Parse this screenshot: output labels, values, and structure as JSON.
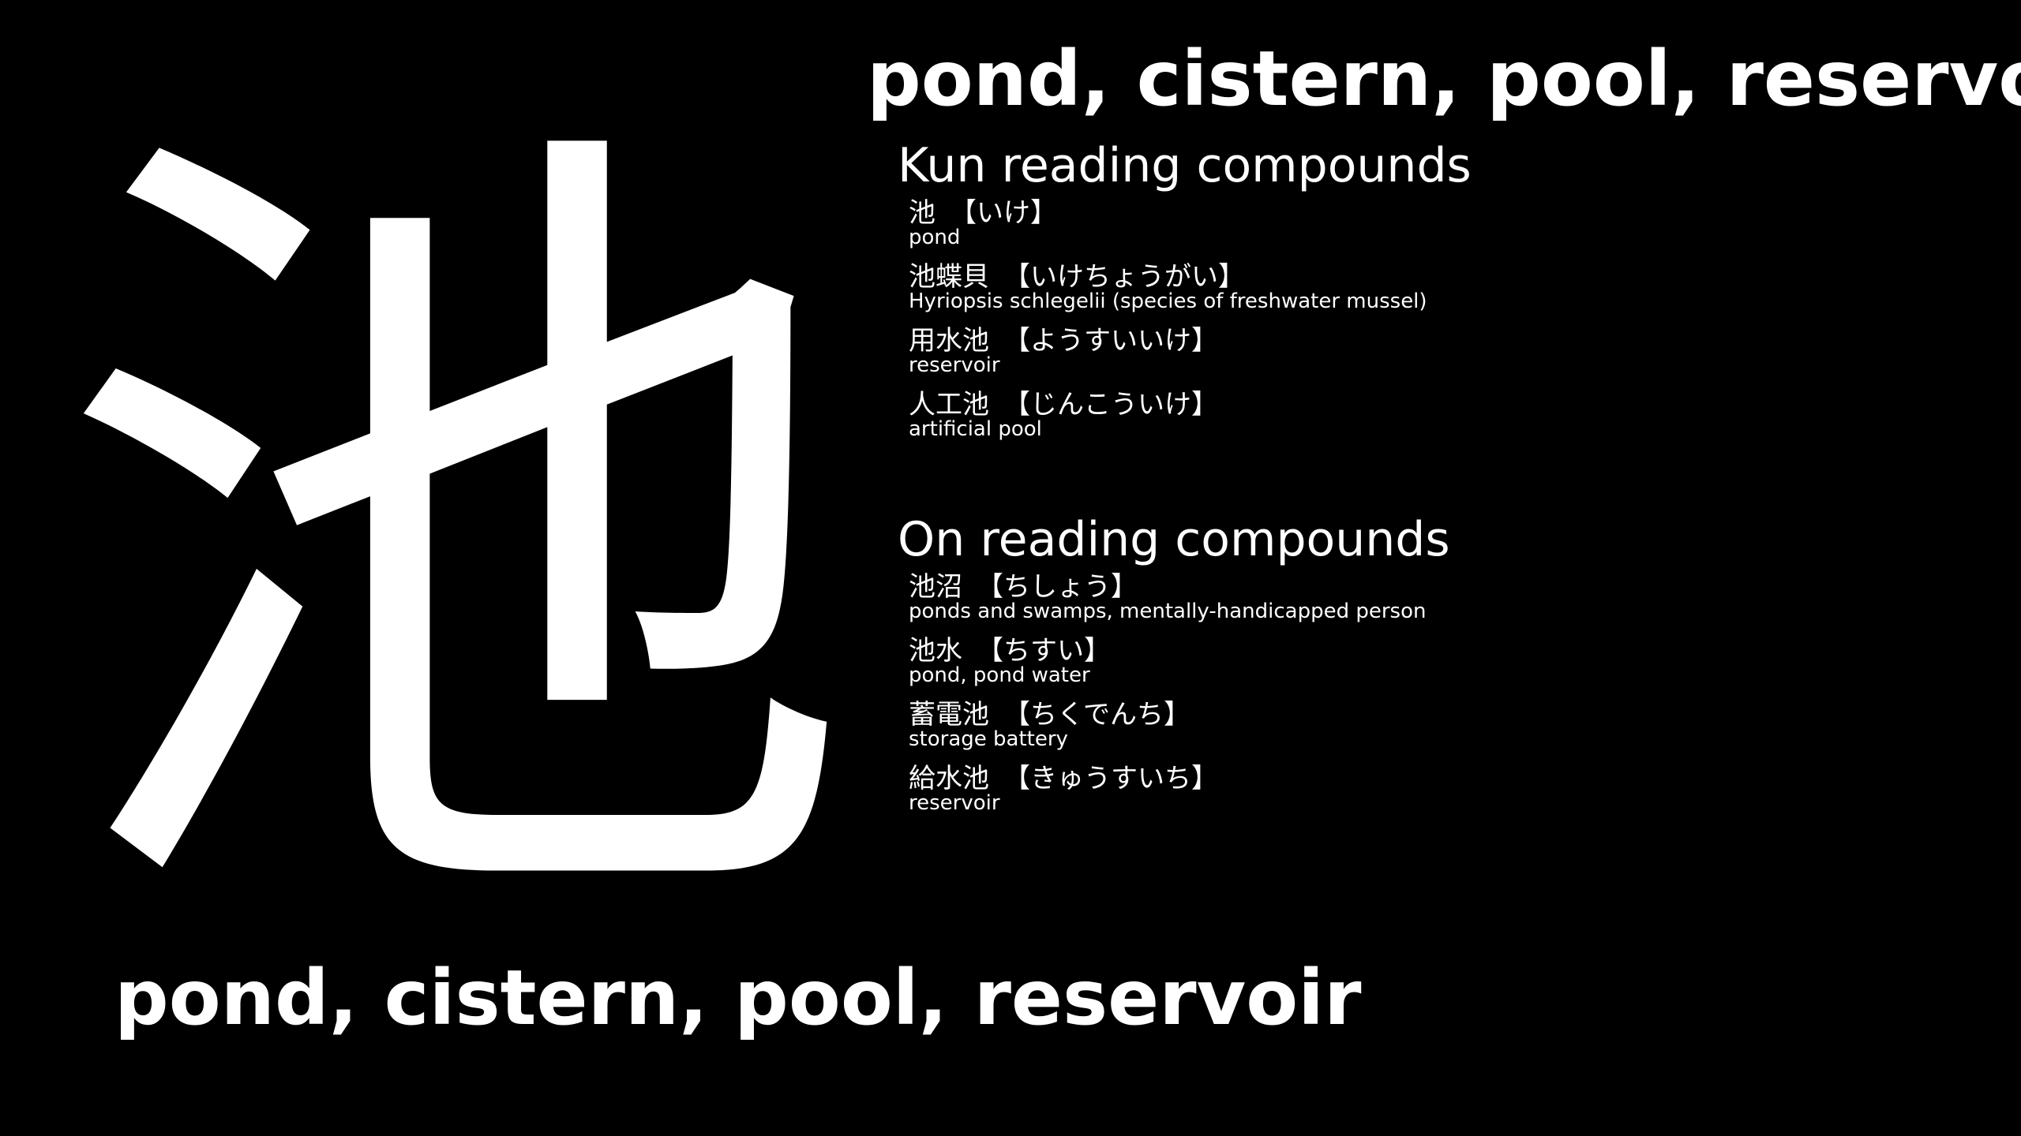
{
  "kanji": "池",
  "meaning": "pond, cistern, pool, reservoir",
  "kun": {
    "heading": "Kun reading compounds",
    "compounds": [
      {
        "word": "池",
        "reading": "【いけ】",
        "definition": "pond"
      },
      {
        "word": "池蝶貝",
        "reading": "【いけちょうがい】",
        "definition": "Hyriopsis schlegelii (species of freshwater mussel)"
      },
      {
        "word": "用水池",
        "reading": "【ようすいいけ】",
        "definition": "reservoir"
      },
      {
        "word": "人工池",
        "reading": "【じんこういけ】",
        "definition": "artificial pool"
      }
    ]
  },
  "on": {
    "heading": "On reading compounds",
    "compounds": [
      {
        "word": "池沼",
        "reading": "【ちしょう】",
        "definition": "ponds and swamps, mentally-handicapped person"
      },
      {
        "word": "池水",
        "reading": "【ちすい】",
        "definition": "pond, pond water"
      },
      {
        "word": "蓄電池",
        "reading": "【ちくでんち】",
        "definition": "storage battery"
      },
      {
        "word": "給水池",
        "reading": "【きゅうすいち】",
        "definition": "reservoir"
      }
    ]
  }
}
